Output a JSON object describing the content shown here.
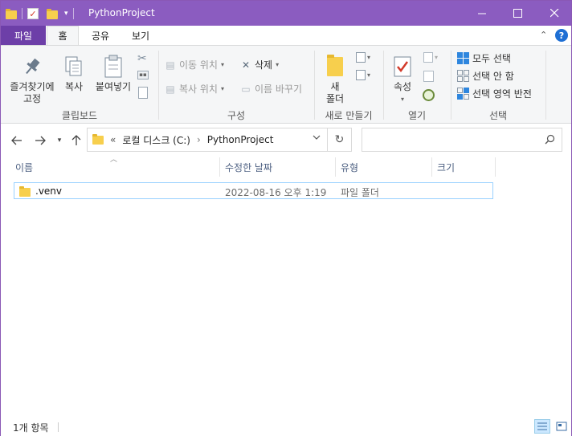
{
  "window": {
    "title": "PythonProject"
  },
  "ribbon_tabs": {
    "file": "파일",
    "home": "홈",
    "share": "공유",
    "view": "보기"
  },
  "ribbon": {
    "clipboard": {
      "pin_label": "즐겨찾기에\n고정",
      "copy_label": "복사",
      "paste_label": "붙여넣기",
      "group_label": "클립보드"
    },
    "organize": {
      "move_to": "이동 위치",
      "copy_to": "복사 위치",
      "delete": "삭제",
      "rename": "이름 바꾸기",
      "group_label": "구성"
    },
    "new": {
      "new_folder_label": "새\n폴더",
      "group_label": "새로 만들기"
    },
    "open": {
      "properties_label": "속성",
      "group_label": "열기"
    },
    "select": {
      "select_all": "모두 선택",
      "select_none": "선택 안 함",
      "invert_selection": "선택 영역 반전",
      "group_label": "선택"
    }
  },
  "address": {
    "overflow": "«",
    "crumbs": [
      "로컬 디스크 (C:)",
      "PythonProject"
    ],
    "search_placeholder": ""
  },
  "columns": {
    "name": "이름",
    "date": "수정한 날짜",
    "type": "유형",
    "size": "크기"
  },
  "files": [
    {
      "name": ".venv",
      "date": "2022-08-16 오후 1:19",
      "type": "파일 폴더",
      "size": ""
    }
  ],
  "status": {
    "count": "1개 항목"
  },
  "colors": {
    "titlebar": "#8b5cc0",
    "file_tab": "#6d3fa8",
    "selection_border": "#99d1ff",
    "folder": "#f7cf4d"
  }
}
